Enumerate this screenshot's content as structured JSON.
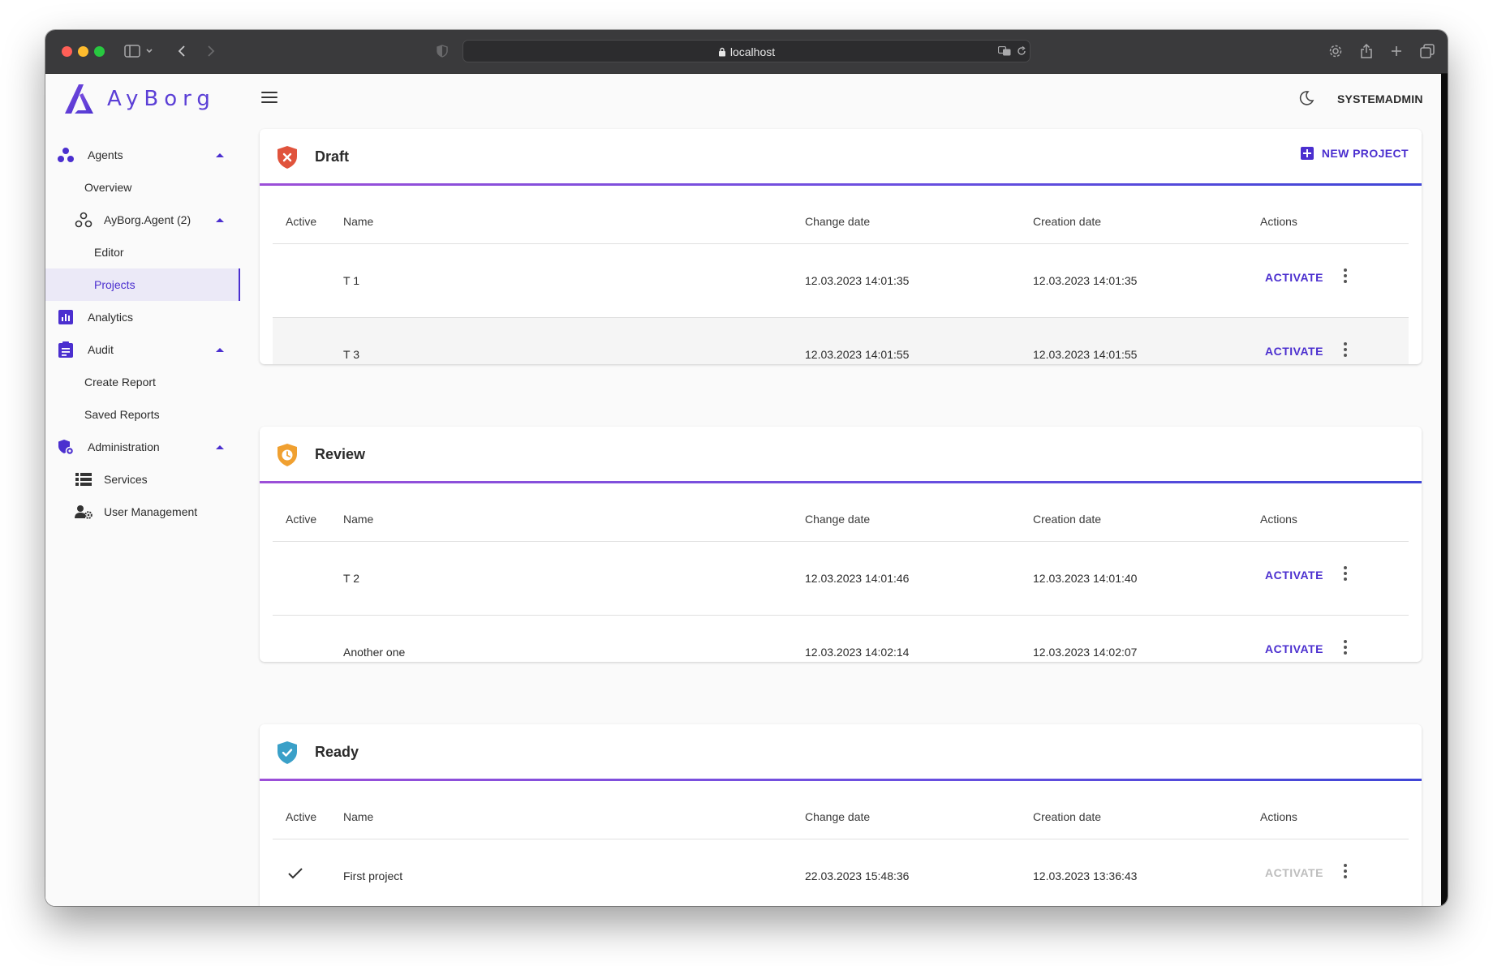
{
  "browser": {
    "url": "localhost"
  },
  "app": {
    "logo_text": "AyBorg",
    "user": "SYSTEMADMIN"
  },
  "sidebar": {
    "agents": "Agents",
    "overview": "Overview",
    "agent": "AyBorg.Agent (2)",
    "editor": "Editor",
    "projects": "Projects",
    "analytics": "Analytics",
    "audit": "Audit",
    "create_report": "Create Report",
    "saved_reports": "Saved Reports",
    "administration": "Administration",
    "services": "Services",
    "user_management": "User Management"
  },
  "columns": {
    "active": "Active",
    "name": "Name",
    "change_date": "Change date",
    "creation_date": "Creation date",
    "actions": "Actions"
  },
  "activate_label": "ACTIVATE",
  "new_project_label": "NEW PROJECT",
  "sections": {
    "draft": {
      "title": "Draft",
      "rows": [
        {
          "name": "T 1",
          "change": "12.03.2023 14:01:35",
          "created": "12.03.2023 14:01:35"
        },
        {
          "name": "T 3",
          "change": "12.03.2023 14:01:55",
          "created": "12.03.2023 14:01:55"
        }
      ]
    },
    "review": {
      "title": "Review",
      "rows": [
        {
          "name": "T 2",
          "change": "12.03.2023 14:01:46",
          "created": "12.03.2023 14:01:40"
        },
        {
          "name": "Another one",
          "change": "12.03.2023 14:02:14",
          "created": "12.03.2023 14:02:07"
        }
      ]
    },
    "ready": {
      "title": "Ready",
      "rows": [
        {
          "name": "First project",
          "change": "22.03.2023 15:48:36",
          "created": "12.03.2023 13:36:43",
          "active": true
        }
      ]
    }
  },
  "colors": {
    "accent": "#4b2fcf",
    "draft": "#e0533c",
    "review": "#f0a030",
    "ready": "#3aa0c8"
  }
}
